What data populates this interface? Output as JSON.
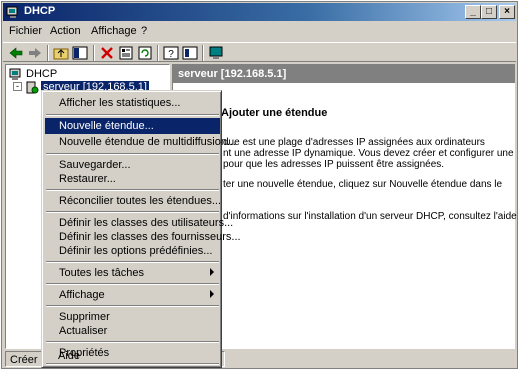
{
  "window": {
    "title": "DHCP",
    "min_label": "_",
    "max_label": "□",
    "close_label": "×"
  },
  "menubar": {
    "items": [
      "Fichier",
      "Action",
      "Affichage",
      "?"
    ]
  },
  "toolbar": {
    "icons": [
      "back-arrow-icon",
      "forward-arrow-icon",
      "up-folder-icon",
      "show-hide-tree-icon",
      "delete-icon",
      "properties-icon",
      "refresh-icon",
      "export-list-icon",
      "help-icon",
      "help-topic-icon",
      "monitor-icon"
    ]
  },
  "tree": {
    "root": "DHCP",
    "server": "serveur [192.168.5.1]"
  },
  "right_pane": {
    "header": "serveur [192.168.5.1]",
    "heading": "Ajouter une étendue",
    "lines": [
      "due est une plage d'adresses IP assignées aux ordinateurs",
      "nt une adresse IP dynamique. Vous devez créer et configurer une",
      "pour que les adresses IP puissent être assignées.",
      "ter une nouvelle étendue, cliquez sur Nouvelle étendue dans le",
      "d'informations sur l'installation d'un serveur DHCP, consultez l'aide"
    ]
  },
  "context_menu": {
    "items": [
      "Afficher les statistiques...",
      "Nouvelle étendue...",
      "Nouvelle étendue de multidiffusion...",
      "Sauvegarder...",
      "Restaurer...",
      "Réconcilier toutes les étendues...",
      "Définir les classes des utilisateurs...",
      "Définir les classes des fournisseurs...",
      "Définir les options prédéfinies...",
      "Toutes les tâches",
      "Affichage",
      "Supprimer",
      "Actualiser",
      "Propriétés",
      "Aide"
    ],
    "selected_index": 1
  },
  "statusbar": {
    "text": "Créer un"
  },
  "colors": {
    "titlebar_start": "#0a246a",
    "titlebar_end": "#a6caf0",
    "selection": "#0a246a",
    "face": "#d4d0c8"
  }
}
